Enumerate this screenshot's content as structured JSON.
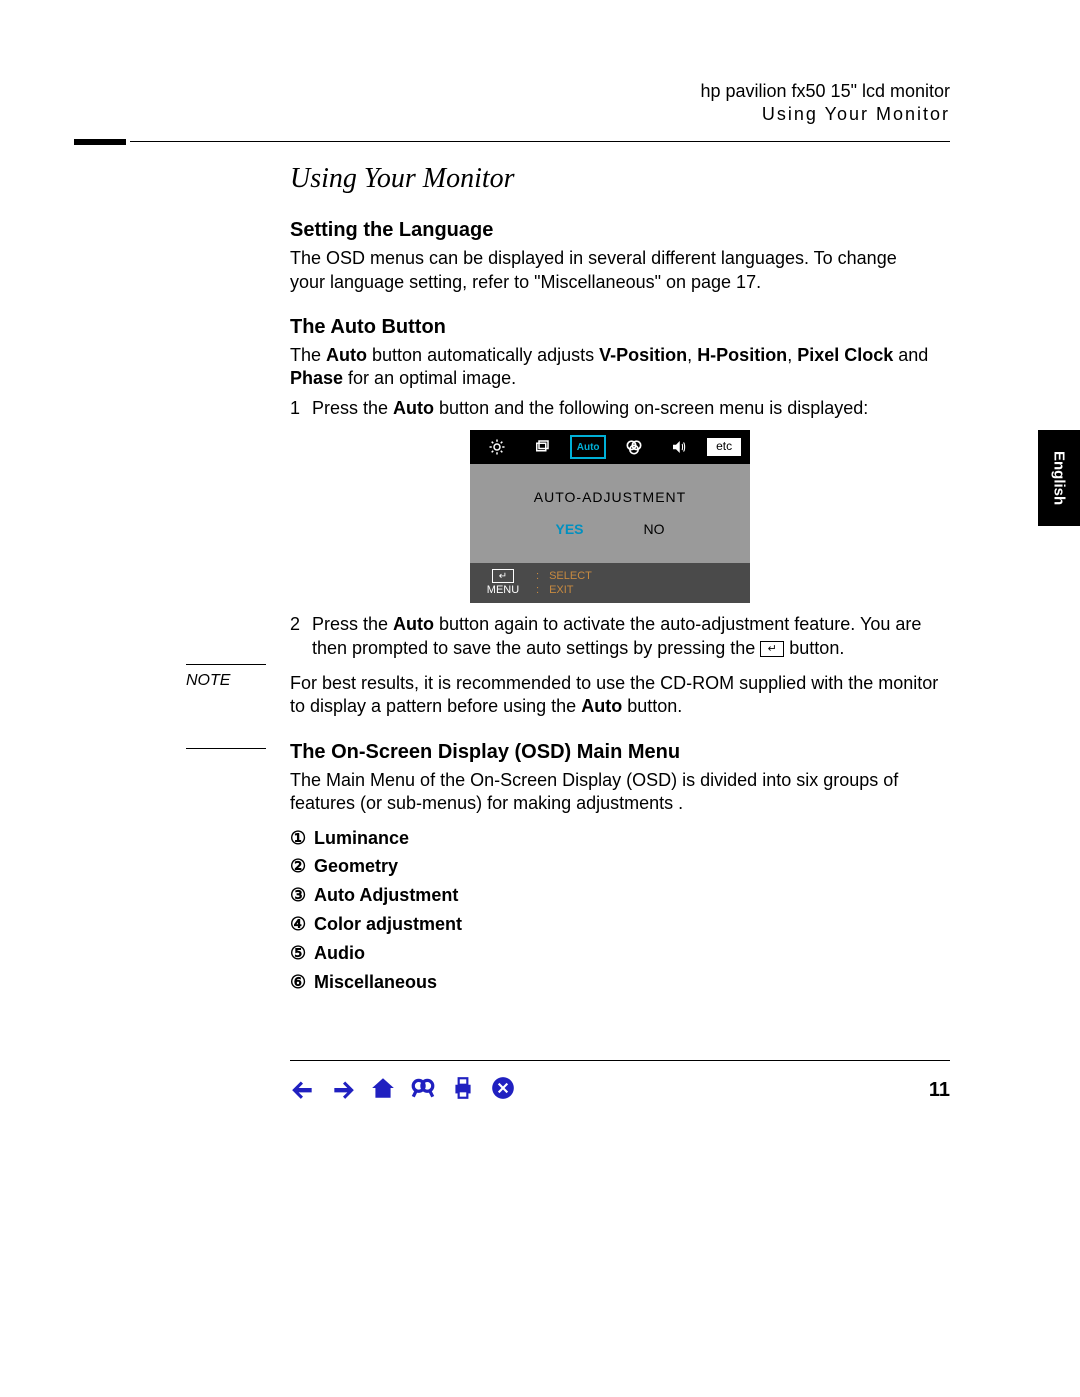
{
  "header": {
    "product": "hp pavilion fx50 15\" lcd monitor",
    "section": "Using Your Monitor"
  },
  "title": "Using Your Monitor",
  "side_tab": "English",
  "s1": {
    "head": "Setting the Language",
    "body": "The OSD menus can be displayed in several different languages. To change your language setting, refer to \"Miscellaneous\" on page 17."
  },
  "s2": {
    "head": "The Auto Button",
    "intro_pre": "The ",
    "intro_auto": "Auto",
    "intro_mid": " button automatically adjusts ",
    "vpos": "V-Position",
    "comma": ", ",
    "hpos": "H-Position",
    "pixel": "Pixel Clock",
    "and": " and ",
    "phase": "Phase",
    "intro_end": " for an optimal image.",
    "step1_num": "1",
    "step1_a": "Press the ",
    "step1_b": "Auto",
    "step1_c": " button and the following on-screen menu is displayed:",
    "step2_num": "2",
    "step2_a": "Press the ",
    "step2_b": "Auto",
    "step2_c": " button again to activate the auto-adjustment feature. You are then prompted to save the auto settings by pressing the ",
    "step2_d": " button."
  },
  "osd": {
    "tab_auto": "Auto",
    "tab_etc": "etc",
    "label": "AUTO-ADJUSTMENT",
    "yes": "YES",
    "no": "NO",
    "menu": "MENU",
    "select": "SELECT",
    "exit": "EXIT",
    "enter_sym": "↵"
  },
  "note": {
    "label": "NOTE",
    "text_a": "For best results, it is recommended to use the CD-ROM supplied with the monitor to display a pattern before using the ",
    "text_b": "Auto",
    "text_c": " button."
  },
  "s3": {
    "head": "The On-Screen Display (OSD) Main Menu",
    "body": "The Main Menu of the On-Screen Display (OSD) is divided into six groups of features (or sub-menus) for making adjustments .",
    "items": [
      {
        "n": "①",
        "label": "Luminance"
      },
      {
        "n": "②",
        "label": "Geometry"
      },
      {
        "n": "③",
        "label": "Auto Adjustment"
      },
      {
        "n": "④",
        "label": "Color adjustment"
      },
      {
        "n": "⑤",
        "label": "Audio"
      },
      {
        "n": "⑥",
        "label": "Miscellaneous"
      }
    ]
  },
  "page_number": "11"
}
